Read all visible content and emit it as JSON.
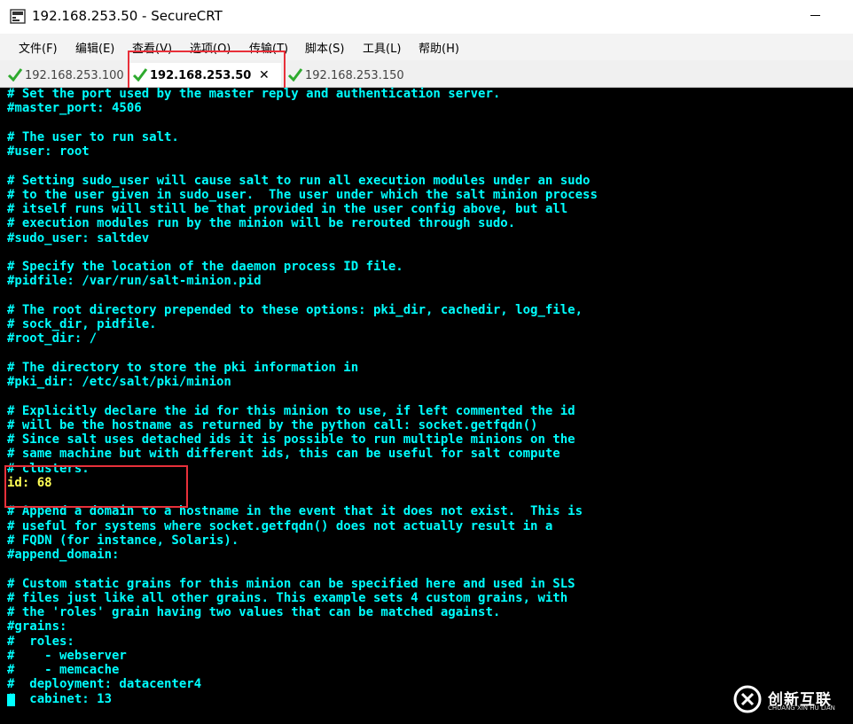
{
  "window": {
    "title": "192.168.253.50 - SecureCRT"
  },
  "menu": [
    "文件(F)",
    "编辑(E)",
    "查看(V)",
    "选项(O)",
    "传输(T)",
    "脚本(S)",
    "工具(L)",
    "帮助(H)"
  ],
  "tabs": [
    {
      "label": "192.168.253.100",
      "active": false
    },
    {
      "label": "192.168.253.50",
      "active": true
    },
    {
      "label": "192.168.253.150",
      "active": false
    }
  ],
  "terminal": {
    "lines": [
      "# Set the port used by the master reply and authentication server.",
      "#master_port: 4506",
      "",
      "# The user to run salt.",
      "#user: root",
      "",
      "# Setting sudo_user will cause salt to run all execution modules under an sudo",
      "# to the user given in sudo_user.  The user under which the salt minion process",
      "# itself runs will still be that provided in the user config above, but all",
      "# execution modules run by the minion will be rerouted through sudo.",
      "#sudo_user: saltdev",
      "",
      "# Specify the location of the daemon process ID file.",
      "#pidfile: /var/run/salt-minion.pid",
      "",
      "# The root directory prepended to these options: pki_dir, cachedir, log_file,",
      "# sock_dir, pidfile.",
      "#root_dir: /",
      "",
      "# The directory to store the pki information in",
      "#pki_dir: /etc/salt/pki/minion",
      "",
      "# Explicitly declare the id for this minion to use, if left commented the id",
      "# will be the hostname as returned by the python call: socket.getfqdn()",
      "# Since salt uses detached ids it is possible to run multiple minions on the",
      "# same machine but with different ids, this can be useful for salt compute",
      "# clusters.",
      "id: 68",
      "",
      "# Append a domain to a hostname in the event that it does not exist.  This is",
      "# useful for systems where socket.getfqdn() does not actually result in a",
      "# FQDN (for instance, Solaris).",
      "#append_domain:",
      "",
      "# Custom static grains for this minion can be specified here and used in SLS",
      "# files just like all other grains. This example sets 4 custom grains, with",
      "# the 'roles' grain having two values that can be matched against.",
      "#grains:",
      "#  roles:",
      "#    - webserver",
      "#    - memcache",
      "#  deployment: datacenter4",
      "#  cabinet: 13"
    ],
    "colors": {
      "background": "#000000",
      "text": "#00ffff",
      "id_line": "#ffff55"
    }
  },
  "watermark": {
    "name": "创新互联",
    "sub": "CHUANG XIN HU LIAN"
  },
  "highlight_color": "#e8303a"
}
